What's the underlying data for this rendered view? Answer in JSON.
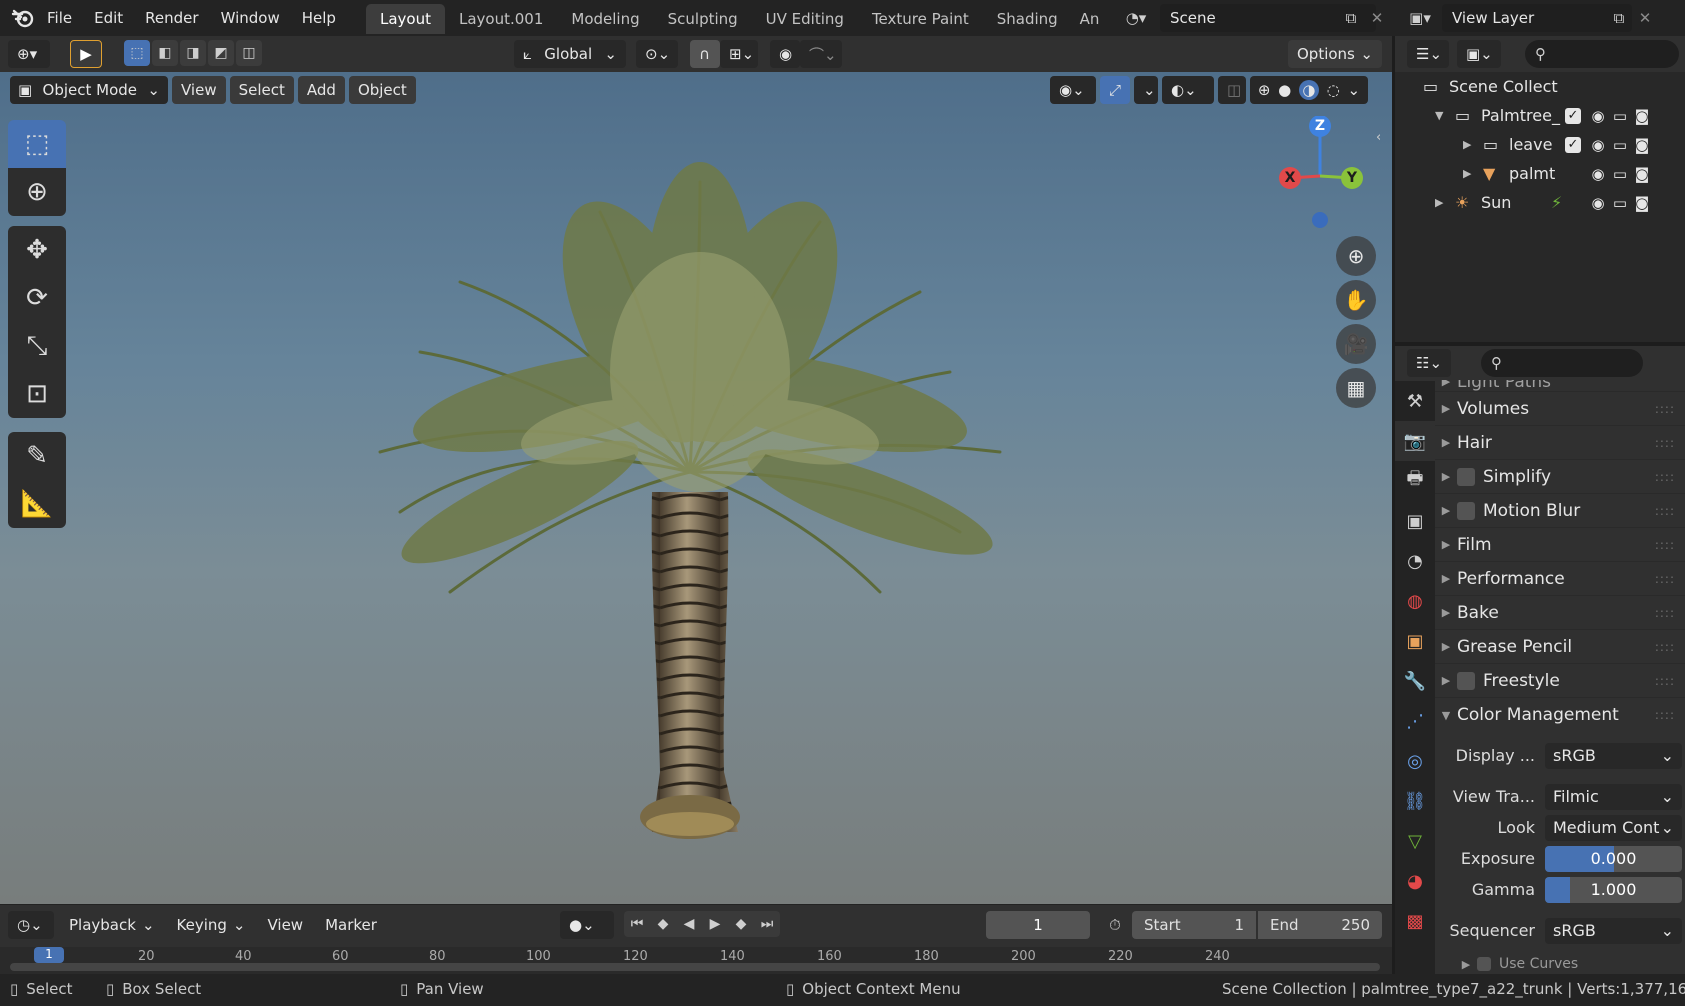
{
  "menu": {
    "items": [
      "File",
      "Edit",
      "Render",
      "Window",
      "Help"
    ]
  },
  "workspaces": {
    "tabs": [
      "Layout",
      "Layout.001",
      "Modeling",
      "Sculpting",
      "UV Editing",
      "Texture Paint",
      "Shading",
      "An"
    ],
    "active": "Layout"
  },
  "scene": {
    "name": "Scene"
  },
  "view_layer": {
    "name": "View Layer"
  },
  "tool_header": {
    "transform_orientation": "Global",
    "options_label": "Options"
  },
  "viewport_header": {
    "mode": "Object Mode",
    "menus": [
      "View",
      "Select",
      "Add",
      "Object"
    ]
  },
  "gizmo": {
    "x": "X",
    "y": "Y",
    "z": "Z"
  },
  "outliner": {
    "root": "Scene Collect",
    "rows": [
      {
        "label": "Palmtree_",
        "level": 1
      },
      {
        "label": "leave",
        "level": 2
      },
      {
        "label": "palmt",
        "level": 2
      },
      {
        "label": "Sun",
        "level": 1
      }
    ]
  },
  "properties": {
    "clipped_top": "Light Paths",
    "panels": [
      {
        "label": "Volumes",
        "checkbox": false
      },
      {
        "label": "Hair",
        "checkbox": false
      },
      {
        "label": "Simplify",
        "checkbox": true
      },
      {
        "label": "Motion Blur",
        "checkbox": true
      },
      {
        "label": "Film",
        "checkbox": false
      },
      {
        "label": "Performance",
        "checkbox": false
      },
      {
        "label": "Bake",
        "checkbox": false
      },
      {
        "label": "Grease Pencil",
        "checkbox": false
      },
      {
        "label": "Freestyle",
        "checkbox": true
      }
    ],
    "color_management": {
      "title": "Color Management",
      "display_label": "Display ...",
      "display_value": "sRGB",
      "view_label": "View Tra...",
      "view_value": "Filmic",
      "look_label": "Look",
      "look_value": "Medium Cont...",
      "exposure_label": "Exposure",
      "exposure_value": "0.000",
      "exposure_fill": 0.5,
      "gamma_label": "Gamma",
      "gamma_value": "1.000",
      "gamma_fill": 0.18,
      "sequencer_label": "Sequencer",
      "sequencer_value": "sRGB",
      "clipped_bottom": "Use Curves"
    }
  },
  "timeline": {
    "menus": [
      "Playback",
      "Keying",
      "View",
      "Marker"
    ],
    "current_frame": "1",
    "start_label": "Start",
    "start_value": "1",
    "end_label": "End",
    "end_value": "250",
    "ticks": [
      "1",
      "20",
      "40",
      "60",
      "80",
      "100",
      "120",
      "140",
      "160",
      "180",
      "200",
      "220",
      "240"
    ]
  },
  "status": {
    "select": "Select",
    "box_select": "Box Select",
    "pan_view": "Pan View",
    "context_menu": "Object Context Menu",
    "info": "Scene Collection | palmtree_type7_a22_trunk | Verts:1,377,16"
  }
}
